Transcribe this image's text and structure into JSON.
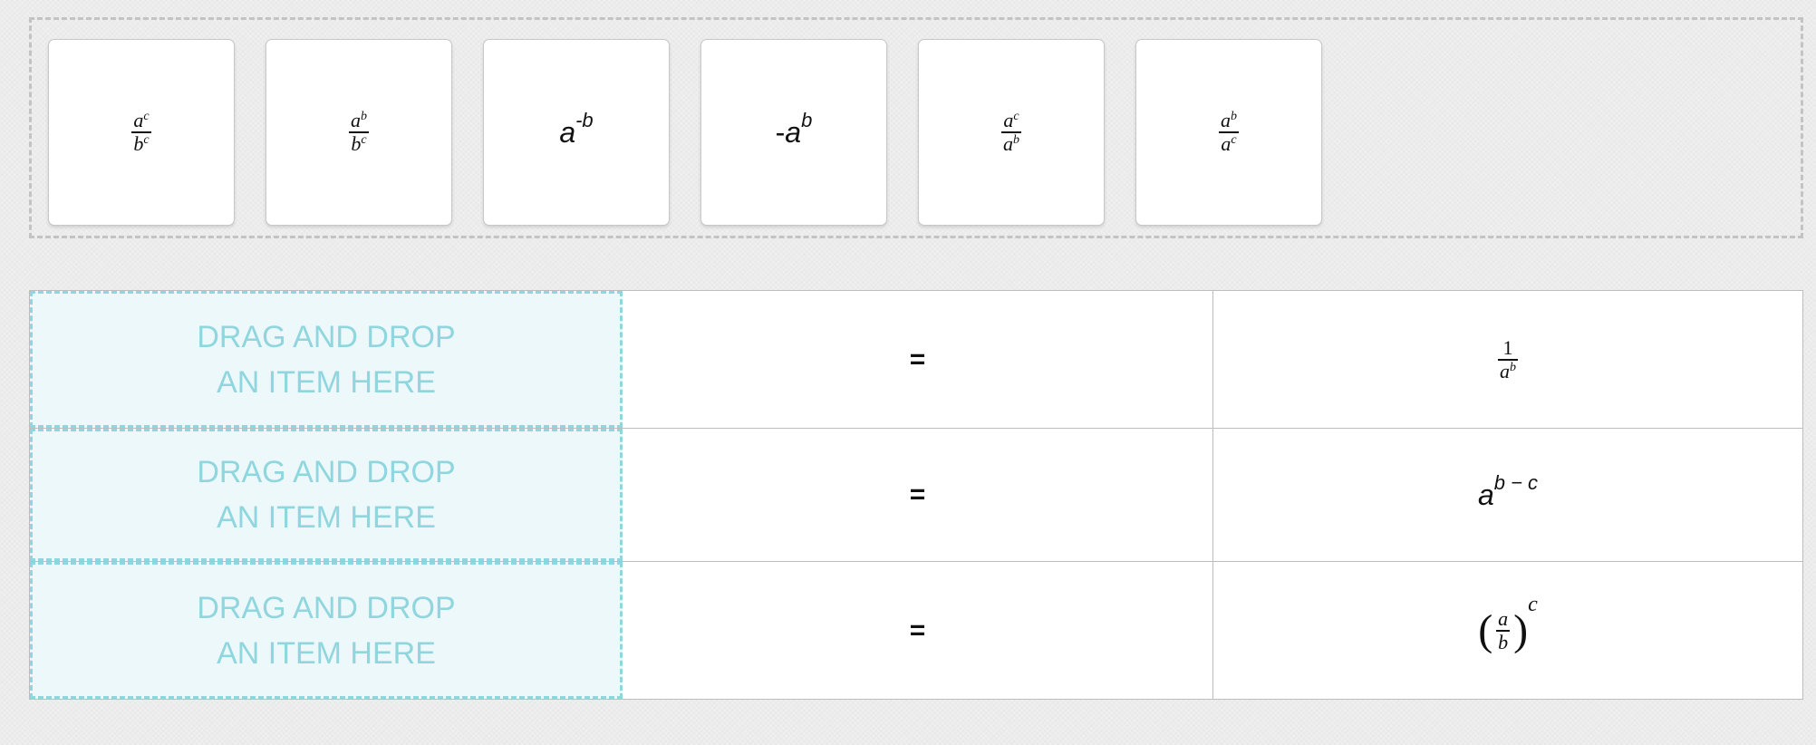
{
  "bank": {
    "tiles": [
      {
        "id": "tile-ac-over-bc",
        "num_base": "a",
        "num_exp": "c",
        "den_base": "b",
        "den_exp": "c"
      },
      {
        "id": "tile-ab-over-bc",
        "num_base": "a",
        "num_exp": "b",
        "den_base": "b",
        "den_exp": "c"
      },
      {
        "id": "tile-a-neg-b",
        "base": "a",
        "exp": "-b"
      },
      {
        "id": "tile-neg-ab",
        "prefix": "-",
        "base": "a",
        "exp": "b"
      },
      {
        "id": "tile-ac-over-ab",
        "num_base": "a",
        "num_exp": "c",
        "den_base": "a",
        "den_exp": "b"
      },
      {
        "id": "tile-ab-over-ac",
        "num_base": "a",
        "num_exp": "b",
        "den_base": "a",
        "den_exp": "c"
      }
    ]
  },
  "table": {
    "drop_line1": "DRAG AND DROP",
    "drop_line2": "AN ITEM HERE",
    "equals": "=",
    "rows": [
      {
        "result": {
          "num": "1",
          "den_base": "a",
          "den_exp": "b"
        }
      },
      {
        "result": {
          "base": "a",
          "exp": "b − c"
        }
      },
      {
        "result": {
          "lparen": "(",
          "num": "a",
          "den": "b",
          "rparen": ")",
          "exp": "c"
        }
      }
    ]
  },
  "colors": {
    "drop_accent": "#8fd6de",
    "drop_bg": "#ecf8fa"
  }
}
